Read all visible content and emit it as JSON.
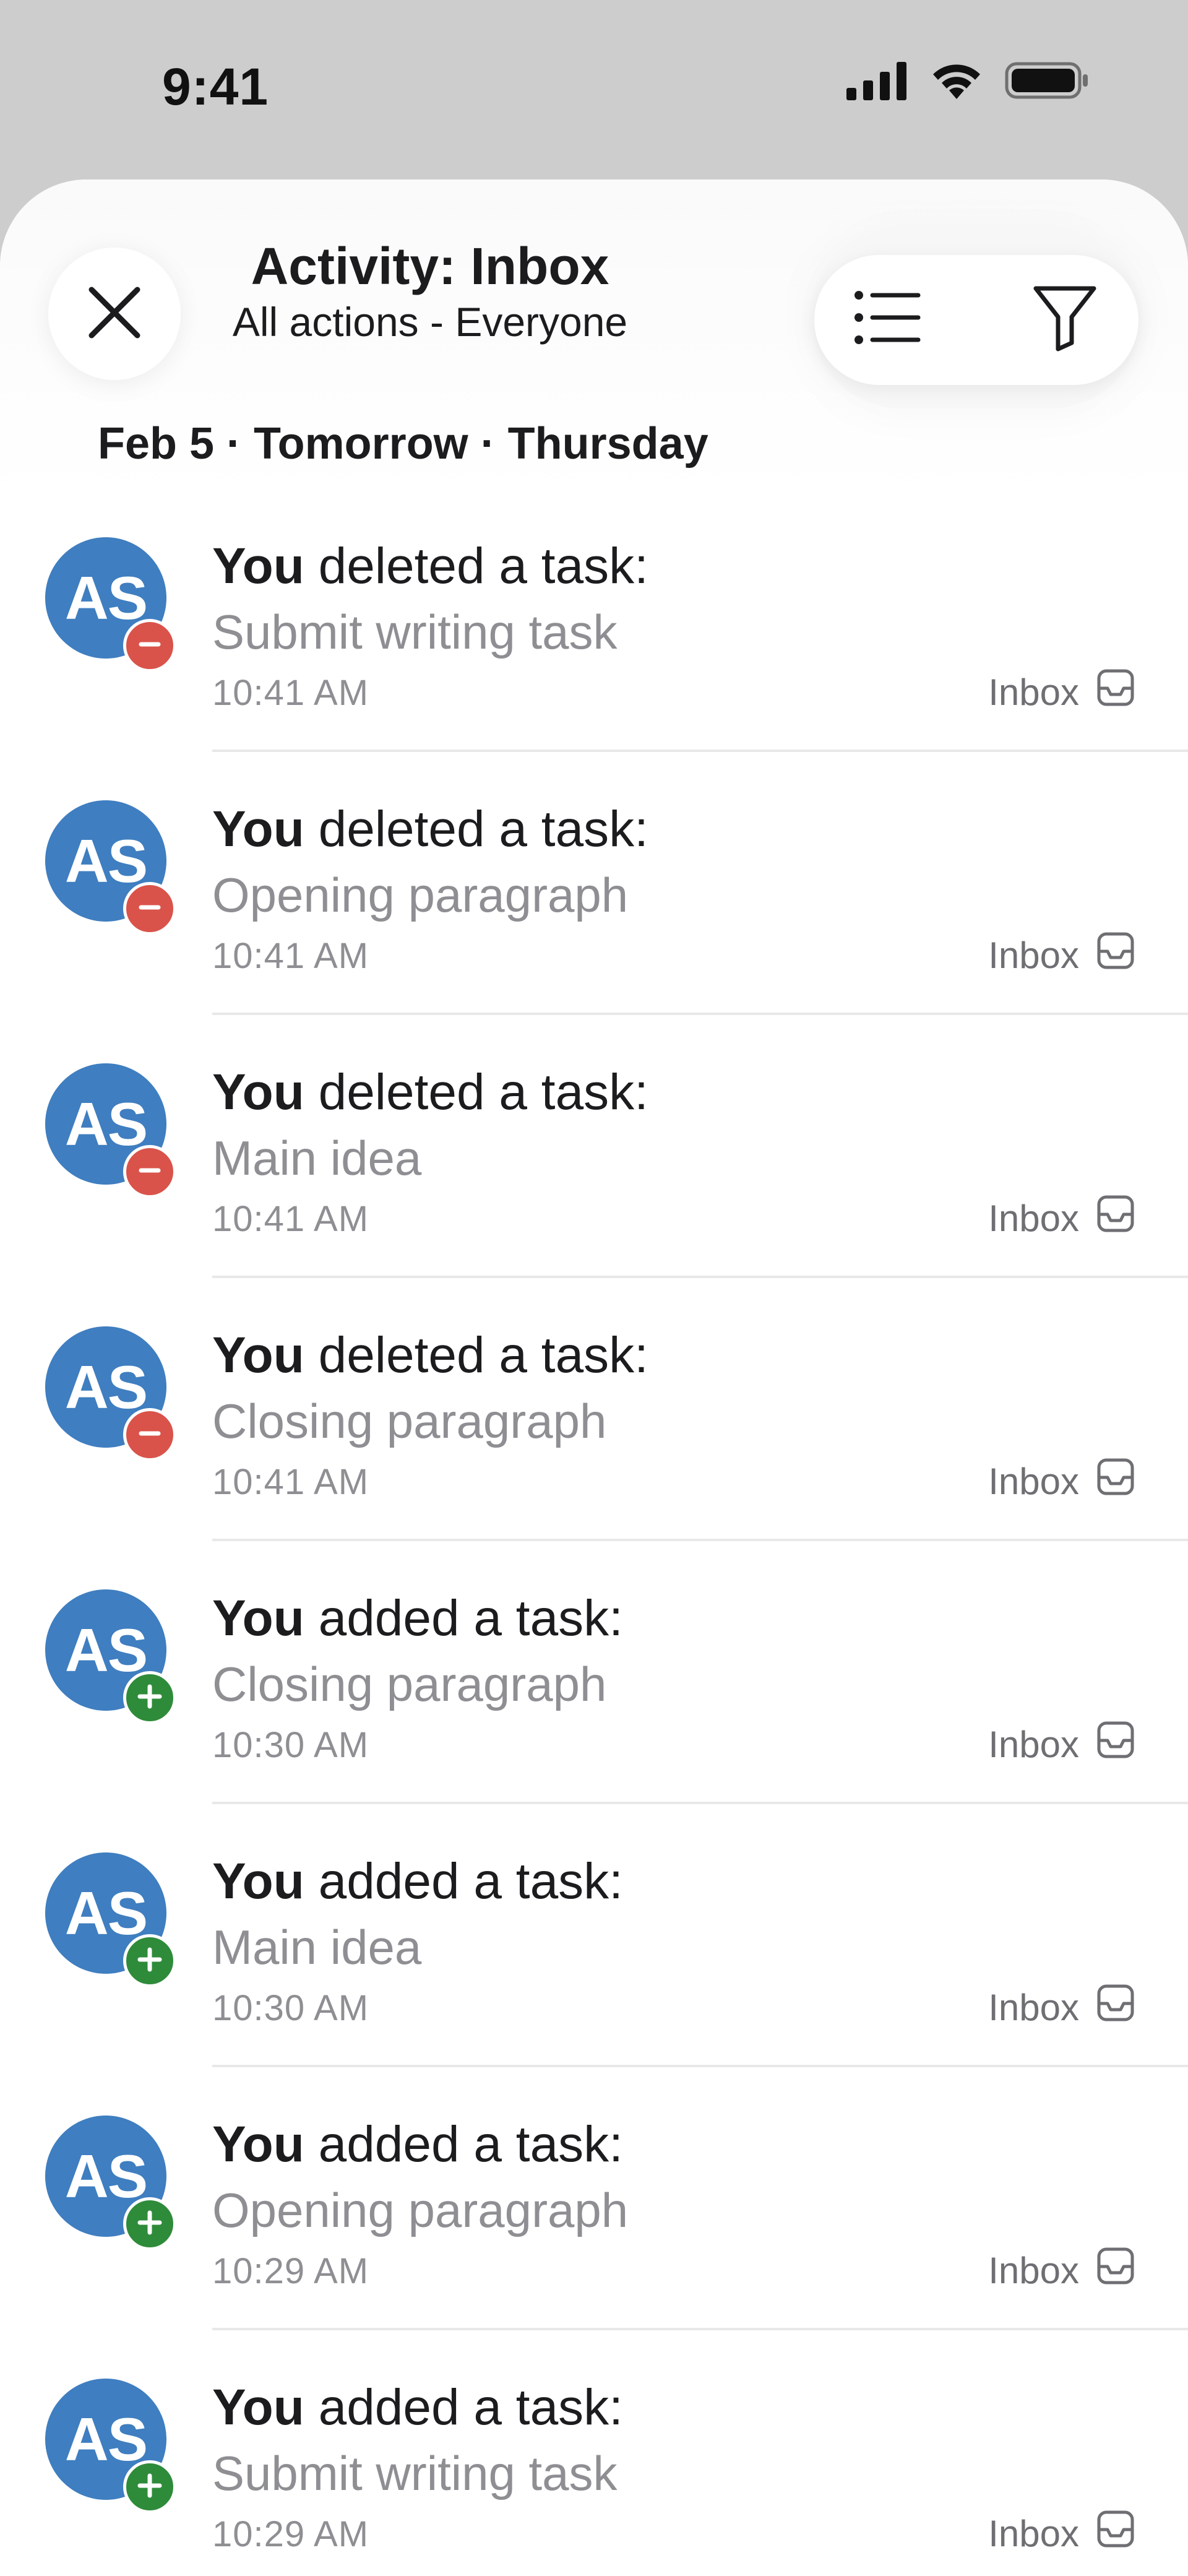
{
  "status_bar": {
    "time": "9:41",
    "icons": [
      "cellular-signal-icon",
      "wifi-icon",
      "battery-icon"
    ]
  },
  "header": {
    "title": "Activity: Inbox",
    "subtitle": "All actions - Everyone",
    "icons": [
      "close-icon",
      "list-icon",
      "filter-icon"
    ]
  },
  "date_heading": "Feb 5 · Tomorrow · Thursday",
  "colors": {
    "avatar": "#3f7ec0",
    "deleted_badge": "#d9534a",
    "added_badge": "#2e8b3a",
    "secondary_text": "#8e8e93"
  },
  "items": [
    {
      "avatar": "AS",
      "actor": "You",
      "action": "deleted a task:",
      "type": "deleted",
      "task": "Submit writing task",
      "time": "10:41 AM",
      "project": "Inbox"
    },
    {
      "avatar": "AS",
      "actor": "You",
      "action": "deleted a task:",
      "type": "deleted",
      "task": "Opening paragraph",
      "time": "10:41 AM",
      "project": "Inbox"
    },
    {
      "avatar": "AS",
      "actor": "You",
      "action": "deleted a task:",
      "type": "deleted",
      "task": "Main idea",
      "time": "10:41 AM",
      "project": "Inbox"
    },
    {
      "avatar": "AS",
      "actor": "You",
      "action": "deleted a task:",
      "type": "deleted",
      "task": "Closing paragraph",
      "time": "10:41 AM",
      "project": "Inbox"
    },
    {
      "avatar": "AS",
      "actor": "You",
      "action": "added a task:",
      "type": "added",
      "task": "Closing paragraph",
      "time": "10:30 AM",
      "project": "Inbox"
    },
    {
      "avatar": "AS",
      "actor": "You",
      "action": "added a task:",
      "type": "added",
      "task": "Main idea",
      "time": "10:30 AM",
      "project": "Inbox"
    },
    {
      "avatar": "AS",
      "actor": "You",
      "action": "added a task:",
      "type": "added",
      "task": "Opening paragraph",
      "time": "10:29 AM",
      "project": "Inbox"
    },
    {
      "avatar": "AS",
      "actor": "You",
      "action": "added a task:",
      "type": "added",
      "task": "Submit writing task",
      "time": "10:29 AM",
      "project": "Inbox"
    }
  ]
}
